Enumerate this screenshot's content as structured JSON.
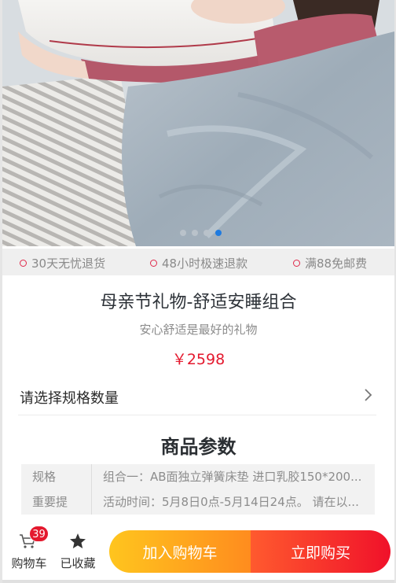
{
  "carousel": {
    "dot_count": 4,
    "active_index": 3
  },
  "services": [
    {
      "label": "30天无忧退货"
    },
    {
      "label": "48小时极速退款"
    },
    {
      "label": "满88免邮费"
    }
  ],
  "product": {
    "title": "母亲节礼物-舒适安睡组合",
    "subtitle": "安心舒适是最好的礼物",
    "price": "￥2598"
  },
  "spec_select": {
    "label": "请选择规格数量"
  },
  "params": {
    "heading": "商品参数",
    "rows": [
      {
        "key": "规格",
        "value": "组合一：AB面独立弹簧床垫 进口乳胶150*200..."
      },
      {
        "key": "重要提",
        "value": "活动时间：5月8日0点-5月14日24点。 请在以..."
      }
    ]
  },
  "bottom_bar": {
    "cart_label": "购物车",
    "cart_count": "39",
    "favorite_label": "已收藏",
    "add_to_cart_label": "加入购物车",
    "buy_now_label": "立即购买"
  },
  "colors": {
    "accent_red": "#e4192e",
    "dot_active": "#1f7be0",
    "cart_gradient_start": "#ffc51e",
    "buy_gradient_end": "#f0112a"
  }
}
